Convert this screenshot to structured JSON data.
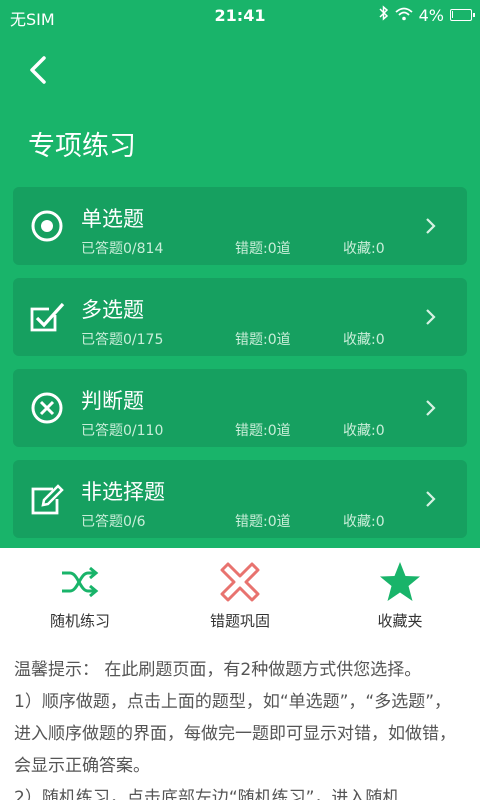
{
  "status_bar": {
    "carrier": "无SIM",
    "time": "21:41",
    "battery": "4%",
    "battery_level": 0.04
  },
  "header": {
    "title": "专项练习"
  },
  "categories": [
    {
      "title": "单选题",
      "answered": "已答题0/814",
      "wrong": "错题:0道",
      "favorite": "收藏:0",
      "icon": "radio-target-icon"
    },
    {
      "title": "多选题",
      "answered": "已答题0/175",
      "wrong": "错题:0道",
      "favorite": "收藏:0",
      "icon": "checkbox-icon"
    },
    {
      "title": "判断题",
      "answered": "已答题0/110",
      "wrong": "错题:0道",
      "favorite": "收藏:0",
      "icon": "x-circle-icon"
    },
    {
      "title": "非选择题",
      "answered": "已答题0/6",
      "wrong": "错题:0道",
      "favorite": "收藏:0",
      "icon": "edit-icon"
    }
  ],
  "tools": [
    {
      "label": "随机练习",
      "icon": "shuffle-icon",
      "color": "#19b46a"
    },
    {
      "label": "错题巩固",
      "icon": "close-x-icon",
      "color": "#e8736f"
    },
    {
      "label": "收藏夹",
      "icon": "star-icon",
      "color": "#19b46a"
    }
  ],
  "tips": {
    "line1": "温馨提示： 在此刷题页面，有2种做题方式供您选择。",
    "line2": "1）顺序做题，点击上面的题型，如“单选题”，“多选题”，进入顺序做题的界面，每做完一题即可显示对错，如做错，会显示正确答案。",
    "line3": "2）随机练习，点击底部左边“随机练习”，进入随机"
  },
  "colors": {
    "primary": "#19b46a",
    "card": "#16a060",
    "danger": "#e8736f"
  }
}
